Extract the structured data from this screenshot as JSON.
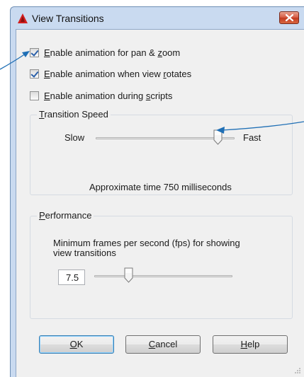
{
  "window": {
    "title": "View Transitions"
  },
  "checkboxes": [
    {
      "label_mn": "E",
      "label_rest": "nable animation for pan & ",
      "label_u": "z",
      "label_tail": "oom",
      "checked": true
    },
    {
      "label_mn": "E",
      "label_rest": "nable animation when view ",
      "label_u": "r",
      "label_tail": "otates",
      "checked": true
    },
    {
      "label_mn": "E",
      "label_rest": "nable animation during ",
      "label_u": "s",
      "label_tail": "cripts",
      "checked": false
    }
  ],
  "transition_speed": {
    "title_mn": "T",
    "title_rest": "ransition Speed",
    "min_label": "Slow",
    "max_label": "Fast",
    "level": 0.88,
    "approx_text": "Approximate time 750 milliseconds"
  },
  "performance": {
    "title_mn": "P",
    "title_rest": "erformance",
    "description_line1": "Minimum frames per second (fps) for showing",
    "description_line2": "view transitions",
    "fps_value": "7.5",
    "level": 0.25
  },
  "buttons": {
    "ok_mn": "O",
    "ok_rest": "K",
    "cancel_mn": "C",
    "cancel_rest": "ancel",
    "help_mn": "H",
    "help_rest": "elp"
  },
  "colors": {
    "accent": "#1f6fb5",
    "title_bar": "#c9daf0",
    "close_red": "#c23b22"
  }
}
